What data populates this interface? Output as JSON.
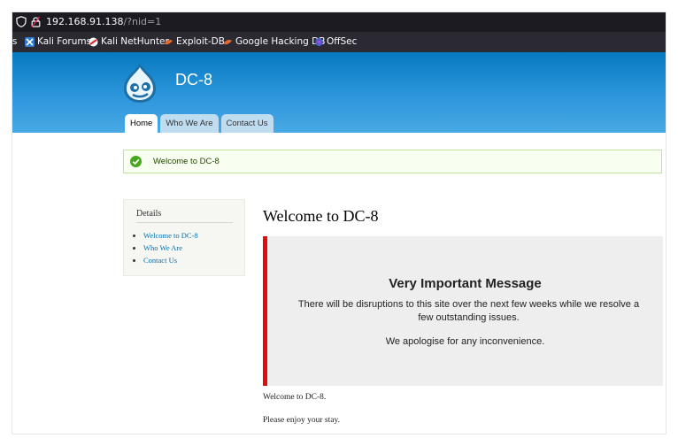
{
  "browser": {
    "url_host": "192.168.91.138",
    "url_path": "/?nid=1",
    "bookmarks": [
      {
        "label": "ls",
        "icon": "kali-icon"
      },
      {
        "label": "Kali Forums",
        "icon": "kali-forums-icon"
      },
      {
        "label": "Kali NetHunter",
        "icon": "nethunter-icon"
      },
      {
        "label": "Exploit-DB",
        "icon": "exploit-db-icon"
      },
      {
        "label": "Google Hacking DB",
        "icon": "ghdb-icon"
      },
      {
        "label": "OffSec",
        "icon": "offsec-icon"
      }
    ]
  },
  "site": {
    "name": "DC-8",
    "logo_icon": "drupal-drop-icon",
    "tabs": [
      {
        "label": "Home",
        "active": true
      },
      {
        "label": "Who We Are",
        "active": false
      },
      {
        "label": "Contact Us",
        "active": false
      }
    ],
    "status_message": "Welcome to DC-8",
    "sidebar": {
      "title": "Details",
      "links": [
        "Welcome to DC-8",
        "Who We Are",
        "Contact Us"
      ]
    },
    "page_title": "Welcome to DC-8",
    "notice": {
      "heading": "Very Important Message",
      "body": "There will be disruptions to this site over the next few weeks while we resolve a few outstanding issues.",
      "apology": "We apologise for any inconvenience."
    },
    "paragraphs": [
      "Welcome to DC-8.",
      "Please enjoy your stay."
    ]
  },
  "colors": {
    "header_blue": "#0779bf",
    "notice_border": "#e60b0b",
    "link": "#0071b3",
    "status_green": "#45a81c"
  }
}
